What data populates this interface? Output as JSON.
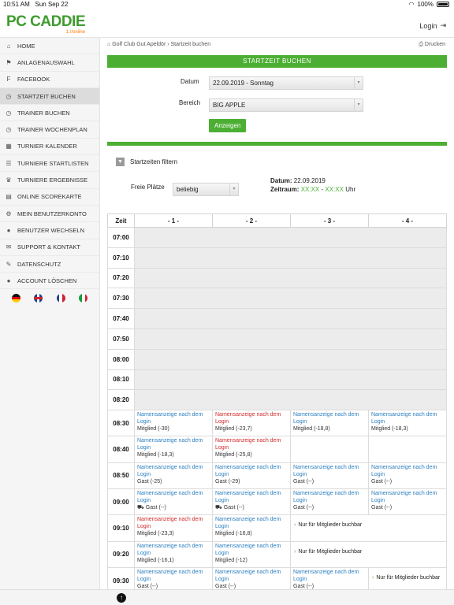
{
  "status": {
    "time": "10:51 AM",
    "date": "Sun Sep 22",
    "battery": "100%"
  },
  "header": {
    "logo": "PC CADDIE",
    "logo_sub": "1://online",
    "login": "Login"
  },
  "sidebar": {
    "items": [
      {
        "label": "HOME",
        "icon": "home-icon",
        "glyph": "⌂"
      },
      {
        "label": "ANLAGENAUSWAHL",
        "icon": "flag-icon",
        "glyph": "⚑"
      },
      {
        "label": "FACEBOOK",
        "icon": "facebook-icon",
        "glyph": "f"
      },
      {
        "label": "STARTZEIT BUCHEN",
        "icon": "clock-icon",
        "glyph": "◷"
      },
      {
        "label": "TRAINER BUCHEN",
        "icon": "clock-icon",
        "glyph": "◷"
      },
      {
        "label": "TRAINER WOCHENPLAN",
        "icon": "clock-icon",
        "glyph": "◷"
      },
      {
        "label": "TURNIER KALENDER",
        "icon": "calendar-icon",
        "glyph": "▦"
      },
      {
        "label": "TURNIERE STARTLISTEN",
        "icon": "list-icon",
        "glyph": "☰"
      },
      {
        "label": "TURNIERE ERGEBNISSE",
        "icon": "trophy-icon",
        "glyph": "♛"
      },
      {
        "label": "ONLINE SCOREKARTE",
        "icon": "table-icon",
        "glyph": "▤"
      },
      {
        "label": "MEIN BENUTZERKONTO",
        "icon": "gears-icon",
        "glyph": "⚙"
      },
      {
        "label": "BENUTZER WECHSELN",
        "icon": "user-icon",
        "glyph": "●"
      },
      {
        "label": "SUPPORT & KONTAKT",
        "icon": "envelope-icon",
        "glyph": "✉"
      },
      {
        "label": "DATENSCHUTZ",
        "icon": "edit-icon",
        "glyph": "✎"
      },
      {
        "label": "ACCOUNT LÖSCHEN",
        "icon": "user-icon",
        "glyph": "●"
      }
    ],
    "active_index": 3
  },
  "breadcrumb": {
    "text": "Golf Club Gut Apeldör › Startzeit buchen",
    "print": "Drucken"
  },
  "page_title": "STARTZEIT BUCHEN",
  "form": {
    "datum_label": "Datum",
    "datum_value": "22.09.2019 - Sonntag",
    "bereich_label": "Bereich",
    "bereich_value": "BIG APPLE",
    "submit": "Anzeigen"
  },
  "filter": {
    "toggle": "Startzeiten filtern",
    "freie_label": "Freie Plätze",
    "freie_value": "beliebig",
    "datum_label": "Datum:",
    "datum_value": "22.09.2019",
    "zeitraum_label": "Zeitraum:",
    "zeitraum_from": "XX:XX",
    "zeitraum_sep": "-",
    "zeitraum_to": "XX:XX",
    "zeitraum_unit": "Uhr"
  },
  "grid": {
    "headers": [
      "Zeit",
      "- 1 -",
      "- 2 -",
      "- 3 -",
      "- 4 -"
    ],
    "empty_times": [
      "07:00",
      "07:10",
      "07:20",
      "07:30",
      "07:40",
      "07:50",
      "08:00",
      "08:10",
      "08:20"
    ],
    "rows": [
      {
        "time": "08:30",
        "slots": [
          {
            "name": "Namensanzeige nach dem Login",
            "color": "blue",
            "info": "Mitglied (-30)"
          },
          {
            "name": "Namensanzeige nach dem Login",
            "color": "red",
            "info": "Mitglied (-23,7)"
          },
          {
            "name": "Namensanzeige nach dem Login",
            "color": "blue",
            "info": "Mitglied (-18,8)"
          },
          {
            "name": "Namensanzeige nach dem Login",
            "color": "blue",
            "info": "Mitglied (-18,3)"
          }
        ]
      },
      {
        "time": "08:40",
        "slots": [
          {
            "name": "Namensanzeige nach dem Login",
            "color": "blue",
            "info": "Mitglied (-18,3)"
          },
          {
            "name": "Namensanzeige nach dem Login",
            "color": "red",
            "info": "Mitglied (-25,8)"
          },
          null,
          null
        ]
      },
      {
        "time": "08:50",
        "slots": [
          {
            "name": "Namensanzeige nach dem Login",
            "color": "blue",
            "info": "Gast (-25)"
          },
          {
            "name": "Namensanzeige nach dem Login",
            "color": "blue",
            "info": "Gast (-29)"
          },
          {
            "name": "Namensanzeige nach dem Login",
            "color": "blue",
            "info": "Gast (--)"
          },
          {
            "name": "Namensanzeige nach dem Login",
            "color": "blue",
            "info": "Gast (--)"
          }
        ]
      },
      {
        "time": "09:00",
        "slots": [
          {
            "name": "Namensanzeige nach dem Login",
            "color": "blue",
            "info": "Gast (--)",
            "cart": true
          },
          {
            "name": "Namensanzeige nach dem Login",
            "color": "blue",
            "info": "Gast (--)",
            "cart": true
          },
          {
            "name": "Namensanzeige nach dem Login",
            "color": "blue",
            "info": "Gast (--)"
          },
          {
            "name": "Namensanzeige nach dem Login",
            "color": "blue",
            "info": "Gast (--)"
          }
        ]
      },
      {
        "time": "09:10",
        "slots": [
          {
            "name": "Namensanzeige nach dem Login",
            "color": "red",
            "info": "Mitglied (-23,3)"
          },
          {
            "name": "Namensanzeige nach dem Login",
            "color": "blue",
            "info": "Mitglied (-16,8)"
          }
        ],
        "members_only": "Nur für Mitglieder buchbar",
        "members_span": 2
      },
      {
        "time": "09:20",
        "slots": [
          {
            "name": "Namensanzeige nach dem Login",
            "color": "blue",
            "info": "Mitglied (-16,1)"
          },
          {
            "name": "Namensanzeige nach dem Login",
            "color": "blue",
            "info": "Mitglied (-12)"
          }
        ],
        "members_only": "Nur für Mitglieder buchbar",
        "members_span": 2
      },
      {
        "time": "09:30",
        "slots": [
          {
            "name": "Namensanzeige nach dem Login",
            "color": "blue",
            "info": "Gast (--)"
          },
          {
            "name": "Namensanzeige nach dem Login",
            "color": "blue",
            "info": "Gast (--)"
          },
          {
            "name": "Namensanzeige nach dem Login",
            "color": "blue",
            "info": "Gast (--)"
          }
        ],
        "members_only": "Nur für Mitglieder buchbar",
        "members_span": 1
      }
    ]
  },
  "colors": {
    "brand_green": "#4caf34",
    "link_blue": "#2a7fc0",
    "red": "#d02a2a"
  }
}
